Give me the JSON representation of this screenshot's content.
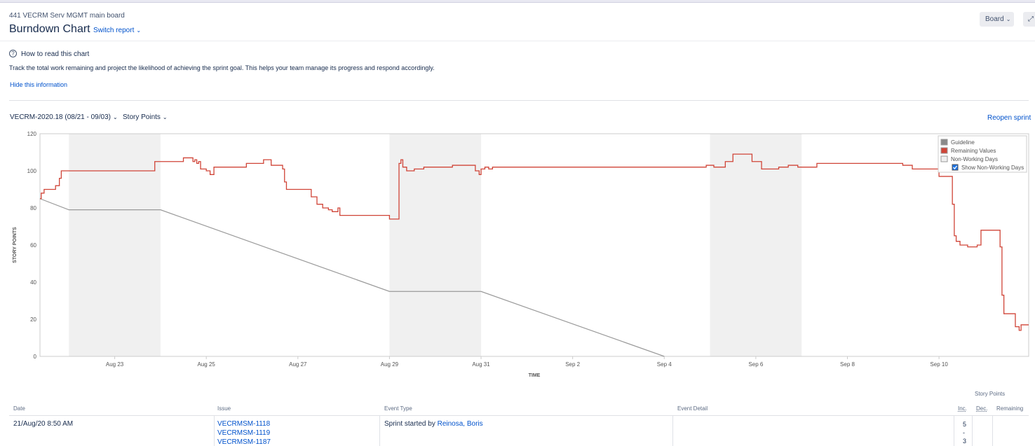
{
  "header": {
    "board_name": "441 VECRM Serv MGMT main board",
    "title": "Burndown Chart",
    "switch_report": "Switch report",
    "board_button": "Board"
  },
  "help": {
    "title": "How to read this chart",
    "description": "Track the total work remaining and project the likelihood of achieving the sprint goal. This helps your team manage its progress and respond accordingly.",
    "hide_link": "Hide this information"
  },
  "controls": {
    "sprint": "VECRM-2020.18 (08/21 - 09/03)",
    "estimation": "Story Points",
    "reopen": "Reopen sprint"
  },
  "chart_data": {
    "type": "line",
    "xlabel": "TIME",
    "ylabel": "STORY POINTS",
    "ylim": [
      0,
      120
    ],
    "yticks": [
      0,
      20,
      40,
      60,
      80,
      100,
      120
    ],
    "xlim_days": [
      "2020-08-21 8:50",
      "2020-09-11 23:00"
    ],
    "xticks": [
      {
        "date": "2020-08-23",
        "label": "Aug 23"
      },
      {
        "date": "2020-08-25",
        "label": "Aug 25"
      },
      {
        "date": "2020-08-27",
        "label": "Aug 27"
      },
      {
        "date": "2020-08-29",
        "label": "Aug 29"
      },
      {
        "date": "2020-08-31",
        "label": "Aug 31"
      },
      {
        "date": "2020-09-02",
        "label": "Sep 2"
      },
      {
        "date": "2020-09-04",
        "label": "Sep 4"
      },
      {
        "date": "2020-09-06",
        "label": "Sep 6"
      },
      {
        "date": "2020-09-08",
        "label": "Sep 8"
      },
      {
        "date": "2020-09-10",
        "label": "Sep 10"
      }
    ],
    "non_working_days": [
      [
        "2020-08-22",
        "2020-08-24"
      ],
      [
        "2020-08-29",
        "2020-08-31"
      ],
      [
        "2020-09-05",
        "2020-09-07"
      ]
    ],
    "legend": {
      "position": "top-right",
      "items": [
        {
          "name": "Guideline",
          "color": "#8a8a8a"
        },
        {
          "name": "Remaining Values",
          "color": "#d04437"
        },
        {
          "name": "Non-Working Days",
          "color": "#f0f0f0"
        }
      ],
      "checkbox_label": "Show Non-Working Days",
      "checkbox_checked": true
    },
    "series": [
      {
        "name": "Guideline",
        "color": "#999999",
        "points": [
          [
            "2020-08-21 8:50",
            85
          ],
          [
            "2020-08-22 0:00",
            79
          ],
          [
            "2020-08-24 0:00",
            79
          ],
          [
            "2020-08-29 0:00",
            35
          ],
          [
            "2020-08-31 0:00",
            35
          ],
          [
            "2020-09-04 0:00",
            0
          ]
        ]
      },
      {
        "name": "Remaining Values",
        "color": "#d04437",
        "step": true,
        "points": [
          [
            "2020-08-21 8:50",
            85
          ],
          [
            "2020-08-21 9:30",
            88
          ],
          [
            "2020-08-21 11:00",
            90
          ],
          [
            "2020-08-21 17:00",
            92
          ],
          [
            "2020-08-21 19:00",
            96
          ],
          [
            "2020-08-21 20:00",
            100
          ],
          [
            "2020-08-23 21:00",
            105
          ],
          [
            "2020-08-24 12:00",
            107
          ],
          [
            "2020-08-24 17:00",
            105
          ],
          [
            "2020-08-24 18:00",
            106
          ],
          [
            "2020-08-24 19:00",
            104
          ],
          [
            "2020-08-24 20:00",
            105
          ],
          [
            "2020-08-24 21:00",
            101
          ],
          [
            "2020-08-25 0:00",
            100
          ],
          [
            "2020-08-25 2:00",
            98
          ],
          [
            "2020-08-25 4:00",
            102
          ],
          [
            "2020-08-25 21:00",
            104
          ],
          [
            "2020-08-26 6:00",
            106
          ],
          [
            "2020-08-26 10:00",
            103
          ],
          [
            "2020-08-26 16:00",
            101
          ],
          [
            "2020-08-26 17:00",
            94
          ],
          [
            "2020-08-26 18:00",
            90
          ],
          [
            "2020-08-27 7:00",
            86
          ],
          [
            "2020-08-27 10:00",
            82
          ],
          [
            "2020-08-27 13:00",
            80
          ],
          [
            "2020-08-27 16:00",
            79
          ],
          [
            "2020-08-27 18:00",
            78
          ],
          [
            "2020-08-27 21:00",
            80
          ],
          [
            "2020-08-27 22:00",
            76
          ],
          [
            "2020-08-28 6:00",
            76
          ],
          [
            "2020-08-29 0:00",
            74
          ],
          [
            "2020-08-29 4:00",
            74
          ],
          [
            "2020-08-29 5:00",
            104
          ],
          [
            "2020-08-29 6:00",
            106
          ],
          [
            "2020-08-29 7:00",
            102
          ],
          [
            "2020-08-29 9:00",
            100
          ],
          [
            "2020-08-29 13:00",
            101
          ],
          [
            "2020-08-29 18:00",
            102
          ],
          [
            "2020-08-30 0:00",
            102
          ],
          [
            "2020-08-30 9:00",
            103
          ],
          [
            "2020-08-30 21:00",
            100
          ],
          [
            "2020-08-30 23:00",
            98
          ],
          [
            "2020-08-31 0:00",
            101
          ],
          [
            "2020-08-31 2:00",
            102
          ],
          [
            "2020-08-31 4:00",
            101
          ],
          [
            "2020-08-31 6:00",
            102
          ],
          [
            "2020-09-04 22:00",
            103
          ],
          [
            "2020-09-05 2:00",
            102
          ],
          [
            "2020-09-05 8:00",
            105
          ],
          [
            "2020-09-05 12:00",
            109
          ],
          [
            "2020-09-05 22:00",
            105
          ],
          [
            "2020-09-06 3:00",
            101
          ],
          [
            "2020-09-06 12:00",
            102
          ],
          [
            "2020-09-06 17:00",
            103
          ],
          [
            "2020-09-06 22:00",
            102
          ],
          [
            "2020-09-07 8:00",
            104
          ],
          [
            "2020-09-09 5:00",
            103
          ],
          [
            "2020-09-09 10:00",
            101
          ],
          [
            "2020-09-10 0:00",
            97
          ],
          [
            "2020-09-10 7:00",
            82
          ],
          [
            "2020-09-10 8:00",
            65
          ],
          [
            "2020-09-10 9:00",
            62
          ],
          [
            "2020-09-10 11:00",
            60
          ],
          [
            "2020-09-10 15:00",
            59
          ],
          [
            "2020-09-10 20:00",
            60
          ],
          [
            "2020-09-10 22:00",
            68
          ],
          [
            "2020-09-11 7:00",
            68
          ],
          [
            "2020-09-11 8:00",
            59
          ],
          [
            "2020-09-11 9:00",
            33
          ],
          [
            "2020-09-11 10:00",
            23
          ],
          [
            "2020-09-11 11:00",
            23
          ],
          [
            "2020-09-11 16:00",
            16
          ],
          [
            "2020-09-11 17:00",
            16
          ],
          [
            "2020-09-11 18:00",
            14
          ],
          [
            "2020-09-11 19:00",
            17
          ]
        ]
      }
    ]
  },
  "table": {
    "story_points_header": "Story Points",
    "columns": [
      "Date",
      "Issue",
      "Event Type",
      "Event Detail",
      "Inc.",
      "Dec.",
      "Remaining"
    ],
    "rows": [
      {
        "date": "21/Aug/20 8:50 AM",
        "issues": [
          "VECRMSM-1118",
          "VECRMSM-1119",
          "VECRMSM-1187"
        ],
        "event_prefix": "Sprint started by",
        "event_user": "Reinosa, Boris",
        "inc_values": [
          "5",
          "-",
          "3"
        ]
      }
    ]
  }
}
